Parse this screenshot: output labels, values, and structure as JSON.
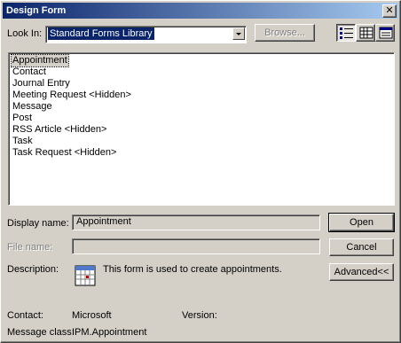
{
  "window": {
    "title": "Design Form",
    "close_glyph": "✕"
  },
  "look_in": {
    "label": "Look In:",
    "value": "Standard Forms Library"
  },
  "buttons": {
    "browse": "Browse...",
    "open": "Open",
    "cancel": "Cancel",
    "advanced": "Advanced<<"
  },
  "view_buttons": [
    {
      "name": "list-view-icon",
      "pressed": true
    },
    {
      "name": "large-icons-view-icon",
      "pressed": false
    },
    {
      "name": "details-view-icon",
      "pressed": false
    }
  ],
  "forms": [
    "Appointment",
    "Contact",
    "Journal Entry",
    "Meeting Request <Hidden>",
    "Message",
    "Post",
    "RSS Article <Hidden>",
    "Task",
    "Task Request <Hidden>"
  ],
  "selected_form_index": 0,
  "details": {
    "display_name_label": "Display name:",
    "display_name_value": "Appointment",
    "file_name_label": "File name:",
    "file_name_value": "",
    "description_label": "Description:",
    "description_icon": "calendar-icon",
    "description_text": "This form is used to create appointments.",
    "contact_label": "Contact:",
    "contact_value": "Microsoft",
    "version_label": "Version:",
    "version_value": "",
    "message_class_label": "Message class:",
    "message_class_value": "IPM.Appointment"
  },
  "colors": {
    "title_bar_start": "#0a246a",
    "title_bar_end": "#a6caf0",
    "face": "#d4d0c8",
    "highlight": "#0a246a"
  }
}
